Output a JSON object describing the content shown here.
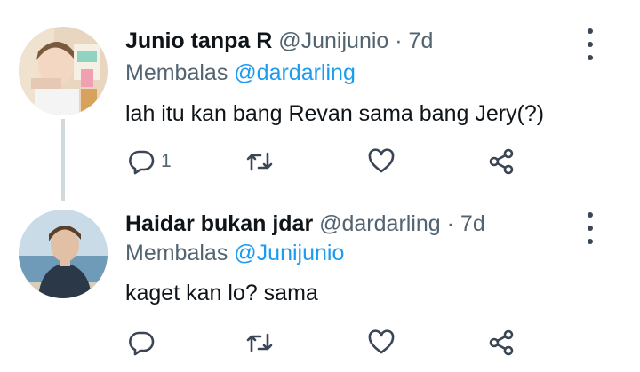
{
  "tweets": [
    {
      "name": "Junio tanpa R",
      "handle": "@Junijunio",
      "separator": "·",
      "time": "7d",
      "reply_prefix": "Membalas",
      "reply_to": "@dardarling",
      "text": "lah itu kan bang Revan sama bang Jery(?)",
      "reply_count": "1"
    },
    {
      "name": "Haidar bukan jdar",
      "handle": "@dardarling",
      "separator": "·",
      "time": "7d",
      "reply_prefix": "Membalas",
      "reply_to": "@Junijunio",
      "text": "kaget kan lo? sama",
      "reply_count": ""
    }
  ],
  "icons": {
    "reply": "reply-icon",
    "retweet": "retweet-icon",
    "like": "heart-icon",
    "share": "share-icon",
    "menu": "more-vertical-icon"
  },
  "colors": {
    "mention": "#1d9bf0",
    "secondary_text": "#536471",
    "primary_text": "#0f1419",
    "icon": "#3b4654",
    "thread_line": "#cfd9de"
  }
}
